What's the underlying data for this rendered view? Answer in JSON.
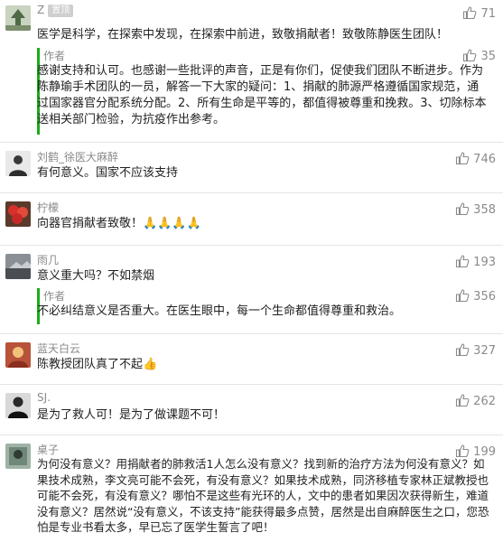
{
  "comments": [
    {
      "name": "Z",
      "badge": "置顶",
      "likes": "71",
      "text": "医学是科学，在探索中发现，在探索中前进，致敬捐献者！致敬陈静医生团队！",
      "reply": {
        "author": "作者",
        "likes": "35",
        "text": "感谢支持和认可。也感谢一些批评的声音，正是有你们，促使我们团队不断进步。作为陈静瑜手术团队的一员，解答一下大家的疑问：1、捐献的肺源严格遵循国家规范，通过国家器官分配系统分配。2、所有生命是平等的，都值得被尊重和挽救。3、切除标本送相关部门检验，为抗疫作出参考。"
      }
    },
    {
      "name": "刘鹤_徐医大麻醉",
      "likes": "746",
      "text": "有何意义。国家不应该支持"
    },
    {
      "name": "柠檬",
      "likes": "358",
      "text": "向器官捐献者致敬！🙏🙏🙏🙏"
    },
    {
      "name": "雨几",
      "likes": "193",
      "text": "意义重大吗？不如禁烟",
      "reply": {
        "author": "作者",
        "likes": "356",
        "text": "不必纠结意义是否重大。在医生眼中，每一个生命都值得尊重和救治。"
      }
    },
    {
      "name": "蓝天白云",
      "likes": "327",
      "text": "陈教授团队真了不起👍"
    },
    {
      "name": "SJ.",
      "likes": "262",
      "text": "是为了救人可！是为了做课题不可！"
    },
    {
      "name": "桌子",
      "likes": "199",
      "text": "为何没有意义？用捐献者的肺救活1人怎么没有意义？找到新的治疗方法为何没有意义？如果技术成熟，李文亮可能不会死，有没有意义？如果技术成熟，同济移植专家林正斌教授也可能不会死，有没有意义？哪怕不是这些有光环的人，文中的患者如果因次获得新生，难道没有意义？居然说“没有意义，不该支持”能获得最多点赞，居然是出自麻醉医生之口，您恐怕是专业书看太多，早已忘了医学生誓言了吧！"
    }
  ],
  "icons": {
    "like": "thumbs-up-icon"
  },
  "colors": {
    "author_bar": "#1aad19",
    "meta": "#8a8a8a",
    "divider": "#e5e5e5"
  }
}
